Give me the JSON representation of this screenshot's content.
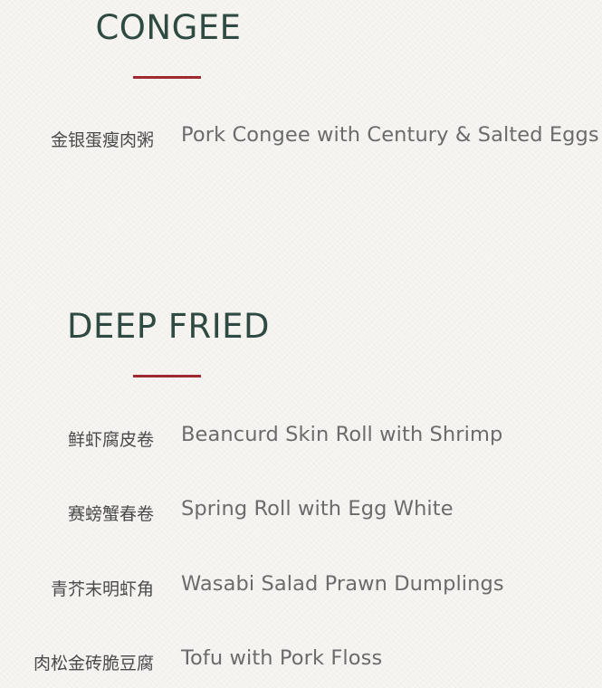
{
  "sections": [
    {
      "title": "CONGEE",
      "items": [
        {
          "zh": "金银蛋瘦肉粥",
          "en": "Pork Congee with Century & Salted Eggs"
        }
      ]
    },
    {
      "title": "DEEP FRIED",
      "items": [
        {
          "zh": "鲜虾腐皮卷",
          "en": "Beancurd Skin Roll with Shrimp"
        },
        {
          "zh": "赛螃蟹春卷",
          "en": "Spring Roll with Egg White"
        },
        {
          "zh": "青芥末明虾角",
          "en": "Wasabi Salad Prawn Dumplings"
        },
        {
          "zh": "肉松金砖脆豆腐",
          "en": "Tofu with Pork Floss"
        }
      ]
    }
  ],
  "colors": {
    "heading": "#2f4a42",
    "rule": "#9e2a2f",
    "chinese_text": "#4a4a4a",
    "english_text": "#6b6b6b",
    "background": "#f7f5f1"
  }
}
